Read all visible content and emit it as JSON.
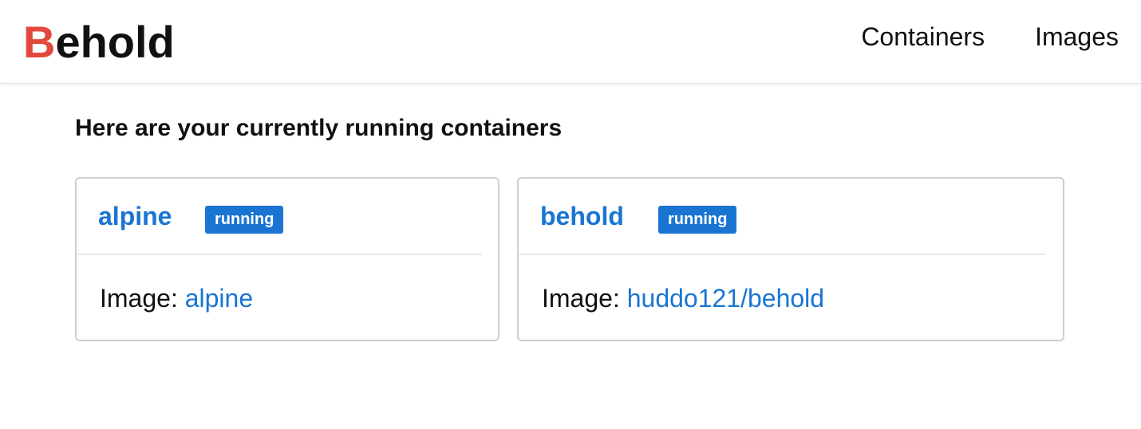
{
  "brand": {
    "first_letter": "B",
    "rest": "ehold"
  },
  "nav": {
    "items": [
      {
        "label": "Containers"
      },
      {
        "label": "Images"
      }
    ]
  },
  "main": {
    "heading": "Here are your currently running containers",
    "image_label": "Image:",
    "containers": [
      {
        "name": "alpine",
        "status": "running",
        "image": "alpine"
      },
      {
        "name": "behold",
        "status": "running",
        "image": "huddo121/behold"
      }
    ]
  },
  "colors": {
    "accent": "#1a75d2",
    "brand_first_letter": "#e2483d",
    "text": "#111111",
    "card_border": "#cfcfcf"
  }
}
